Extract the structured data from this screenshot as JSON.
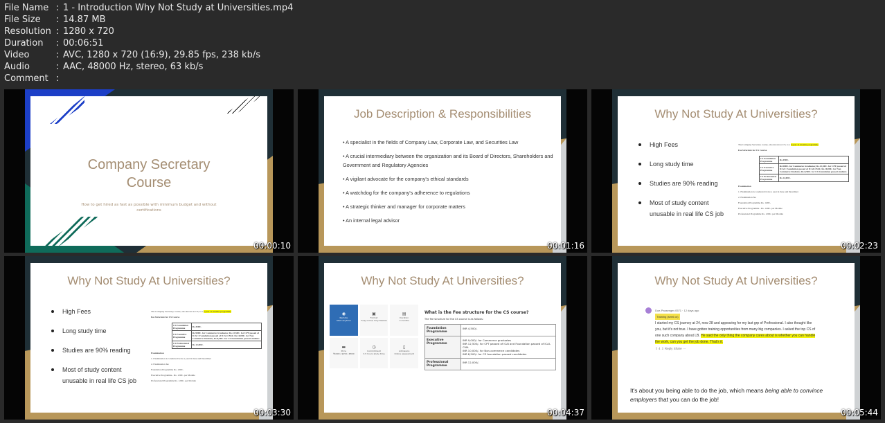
{
  "info": [
    {
      "key": "File Name",
      "value": "1 - Introduction Why Not Study at Universities.mp4"
    },
    {
      "key": "File Size",
      "value": "14.87 MB"
    },
    {
      "key": "Resolution",
      "value": "1280 x 720"
    },
    {
      "key": "Duration",
      "value": "00:06:51"
    },
    {
      "key": "Video",
      "value": "AVC, 1280 x 720 (16:9), 29.85 fps, 238 kb/s"
    },
    {
      "key": "Audio",
      "value": "AAC, 48000 Hz, stereo, 63 kb/s"
    },
    {
      "key": "Comment",
      "value": ""
    }
  ],
  "separator": ":",
  "thumbs": [
    {
      "time": "00:00:10",
      "title": "Company Secretary Course",
      "subtitle": "How to get hired as fast as possible with minimum budget and without certifications"
    },
    {
      "time": "00:01:16",
      "title": "Job Description & Responsibilities",
      "bullets": [
        "• A specialist in the fields of Company Law, Corporate Law, and Securities Law",
        "• A crucial intermediary between the organization and its Board of Directors, Shareholders and Government and Regulatory Agencies",
        "• A vigilant advocate for the company's ethical standards",
        "• A watchdog for the company's adherence to regulations",
        "• A strategic thinker and manager for corporate matters",
        "• An internal legal advisor"
      ]
    },
    {
      "time": "00:02:23",
      "title": "Why Not Study At Universities?"
    },
    {
      "time": "00:03:30",
      "title": "Why Not Study At Universities?"
    },
    {
      "time": "00:04:37",
      "title": "Why Not Study At Universities?"
    },
    {
      "time": "00:05:44",
      "title": "Why Not Study At Universities?"
    }
  ],
  "why": {
    "bullets": [
      "High Fees",
      "Long study time",
      "Studies are 90% reading",
      "Most of study content unusable in real life CS job"
    ],
    "intro": "The Company Secretary course, also known as CS, is a ",
    "highlight": "3-year 11 months programme",
    "fee_heading": "Fee Structure for CS Course",
    "rows": [
      [
        "CS Foundation Programme",
        "Rs.4500/-"
      ],
      [
        "CS Executive Programme",
        "Rs.9000/- for Commerce Graduates; Rs.12,500/- for CPT passed of ICAI / Foundation passed of ICAI-CMA; Rs.10,000/- for Non Commerce Students; Rs.8,500/- for CS Foundation passed students"
      ],
      [
        "CS Professional Programme",
        "Rs.12,000/-"
      ]
    ],
    "exam": "Examination",
    "exam1": "1. Examination is conducted twice a year in June and December",
    "exam2": "2. Examination fee",
    "fees": [
      "Foundation Programme  Rs. 1200/-",
      "Executive Programme  - Rs. 1200/- per Module",
      "Professional Programme  Rs. 1200/- per Module"
    ]
  },
  "slide5": {
    "tiles": [
      [
        "Remote",
        "Start anytime"
      ],
      [
        "Format",
        "Fully online, fully flexible"
      ],
      [
        "Duration",
        "3 months"
      ],
      [
        "Price",
        "₹6999 | $450 | €800"
      ],
      [
        "Commitment",
        "3-5 hours study time"
      ],
      [
        "Admission",
        "Online assessment"
      ]
    ],
    "heading": "What is the Fee structure for the CS course?",
    "sub": "The fee structure for the CS course is as follows:",
    "rows": [
      [
        "Foundation Programme",
        "INR 4,500/-"
      ],
      [
        "Executive Programme",
        "INR 9,000/- for Commerce graduates\nINR 12,500/- for CPT passed of ICAI and Foundation passed of ICAI-CMA\nINR 10,000/- for Non-commerce candidates\nINR 8,500/- for CS foundation passed candidates"
      ],
      [
        "Professional Programme",
        "INR 12,000/-"
      ]
    ]
  },
  "slide6": {
    "user": "Due-Passenger-0571",
    "age": "· 12 days ago",
    "flair": "Training (semi cs)",
    "text": "I started my CS journey at 24, now 28 and appearing for my last grp of Professional. I also thought like you, but it's not true. I have gotten training opportunities from many big companies. I asked the top CS of one such company about LB. ",
    "highlight": "He said the only thing the company cares about is whether you can handle the work, can you get the job done. That's it.",
    "votes": "4",
    "reply": "Reply",
    "share": "Share",
    "more": "···",
    "quote1": "It's about you being able to do the job, which means ",
    "quote_em": "being able to convince employers",
    "quote2": " that you can do the job!"
  }
}
